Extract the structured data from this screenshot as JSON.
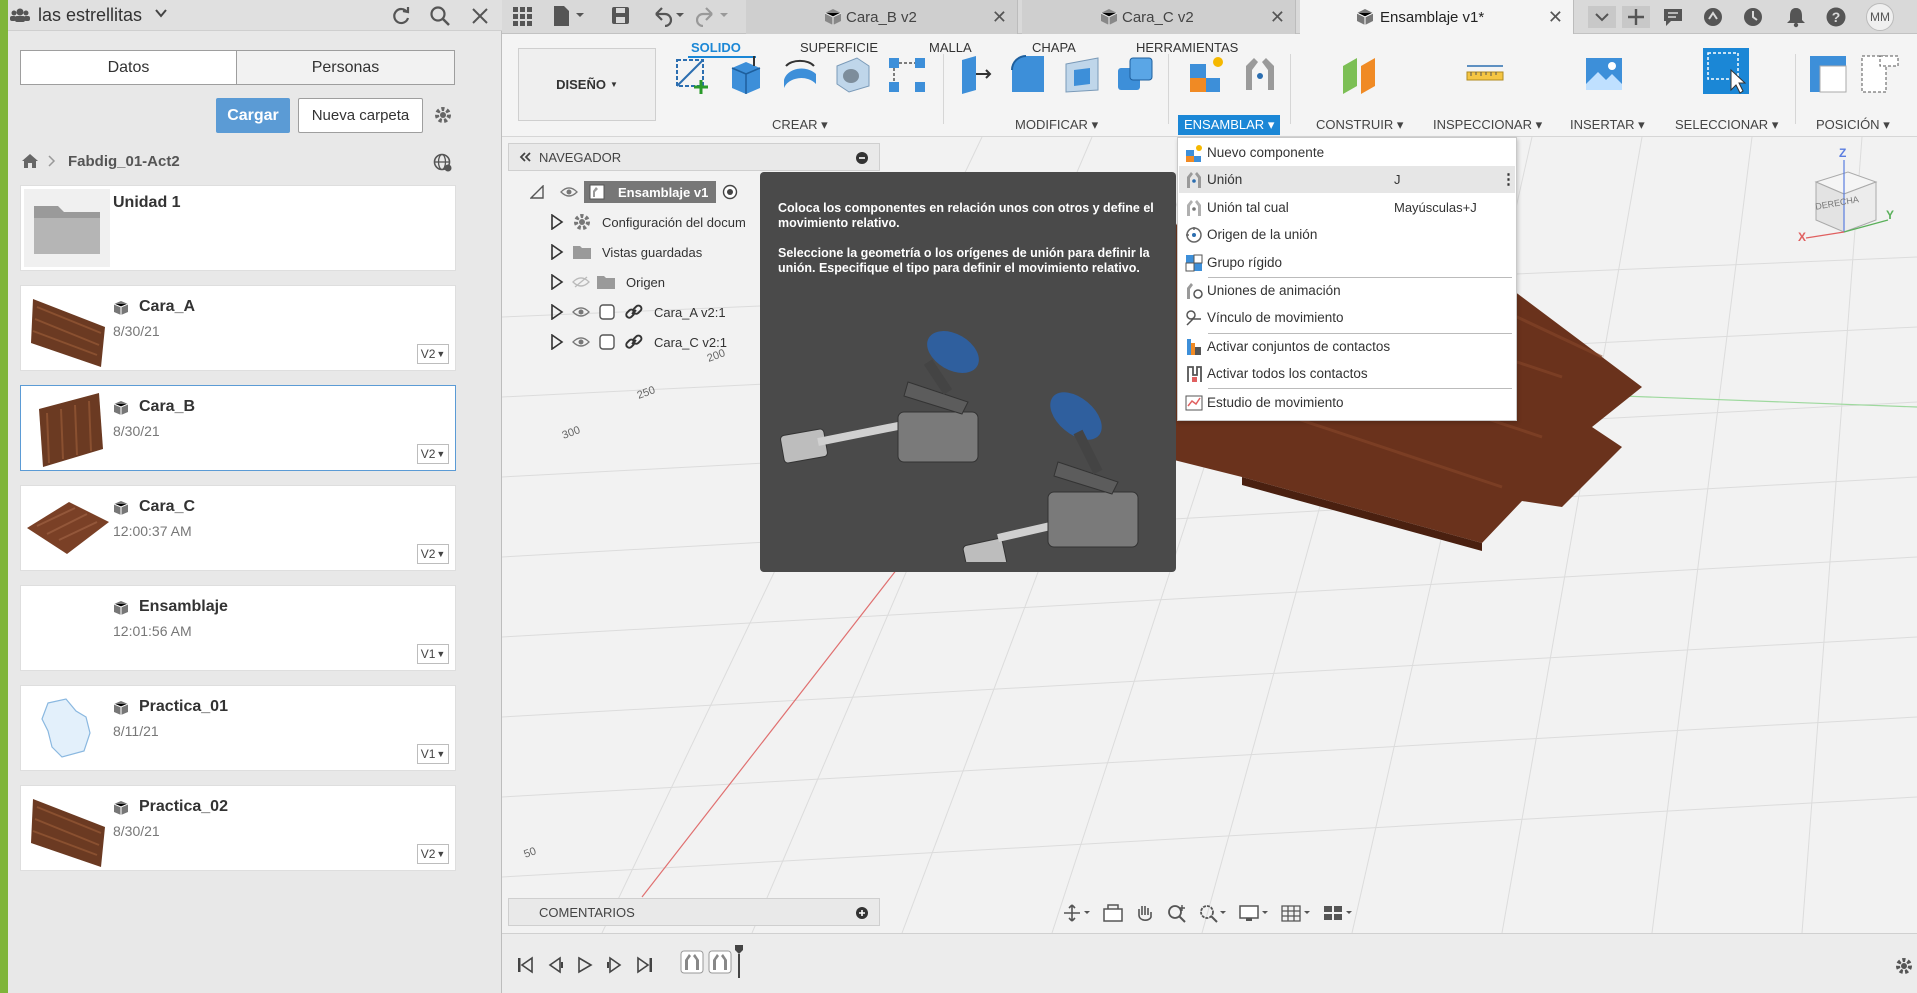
{
  "left_panel": {
    "team_name": "las estrellitas",
    "tabs": [
      "Datos",
      "Personas"
    ],
    "upload_label": "Cargar",
    "new_folder_label": "Nueva carpeta",
    "breadcrumb": "Fabdig_01-Act2",
    "items": [
      {
        "name": "Unidad 1",
        "date": "",
        "version": ""
      },
      {
        "name": "Cara_A",
        "date": "8/30/21",
        "version": "V2"
      },
      {
        "name": "Cara_B",
        "date": "8/30/21",
        "version": "V2"
      },
      {
        "name": "Cara_C",
        "date": "12:00:37 AM",
        "version": "V2"
      },
      {
        "name": "Ensamblaje",
        "date": "12:01:56 AM",
        "version": "V1"
      },
      {
        "name": "Practica_01",
        "date": "8/11/21",
        "version": "V1"
      },
      {
        "name": "Practica_02",
        "date": "8/30/21",
        "version": "V2"
      }
    ]
  },
  "doc_tabs": [
    {
      "label": "Cara_B v2"
    },
    {
      "label": "Cara_C v2"
    },
    {
      "label": "Ensamblaje v1*"
    }
  ],
  "user_initials": "MM",
  "toolbar": {
    "workspace": "DISEÑO",
    "tabs": [
      "SOLIDO",
      "SUPERFICIE",
      "MALLA",
      "CHAPA",
      "HERRAMIENTAS"
    ],
    "groups": [
      "CREAR",
      "MODIFICAR",
      "ENSAMBLAR",
      "CONSTRUIR",
      "INSPECCIONAR",
      "INSERTAR",
      "SELECCIONAR",
      "POSICIÓN"
    ]
  },
  "navigator": {
    "title": "NAVEGADOR",
    "root": "Ensamblaje v1",
    "rows": [
      "Configuración del docum",
      "Vistas guardadas",
      "Origen",
      "Cara_A v2:1",
      "Cara_C v2:1"
    ]
  },
  "tooltip": {
    "line1": "Coloca los componentes en relación unos con otros y define el movimiento relativo.",
    "line2": "Seleccione la geometría o los orígenes de unión para definir la unión. Especifique el tipo para definir el movimiento relativo."
  },
  "menu": {
    "items": [
      {
        "label": "Nuevo componente",
        "shortcut": ""
      },
      {
        "label": "Unión",
        "shortcut": "J"
      },
      {
        "label": "Unión tal cual",
        "shortcut": "Mayúsculas+J"
      },
      {
        "label": "Origen de la unión",
        "shortcut": ""
      },
      {
        "label": "Grupo rígido",
        "shortcut": ""
      },
      {
        "label": "Uniones de animación",
        "shortcut": ""
      },
      {
        "label": "Vínculo de movimiento",
        "shortcut": ""
      },
      {
        "label": "Activar conjuntos de contactos",
        "shortcut": ""
      },
      {
        "label": "Activar todos los contactos",
        "shortcut": ""
      },
      {
        "label": "Estudio de movimiento",
        "shortcut": ""
      }
    ]
  },
  "viewcube": {
    "face": "DERECHA",
    "z": "Z",
    "y": "Y",
    "x": "X"
  },
  "grid_labels": [
    "200",
    "250",
    "300",
    "50"
  ],
  "comments_label": "COMENTARIOS"
}
